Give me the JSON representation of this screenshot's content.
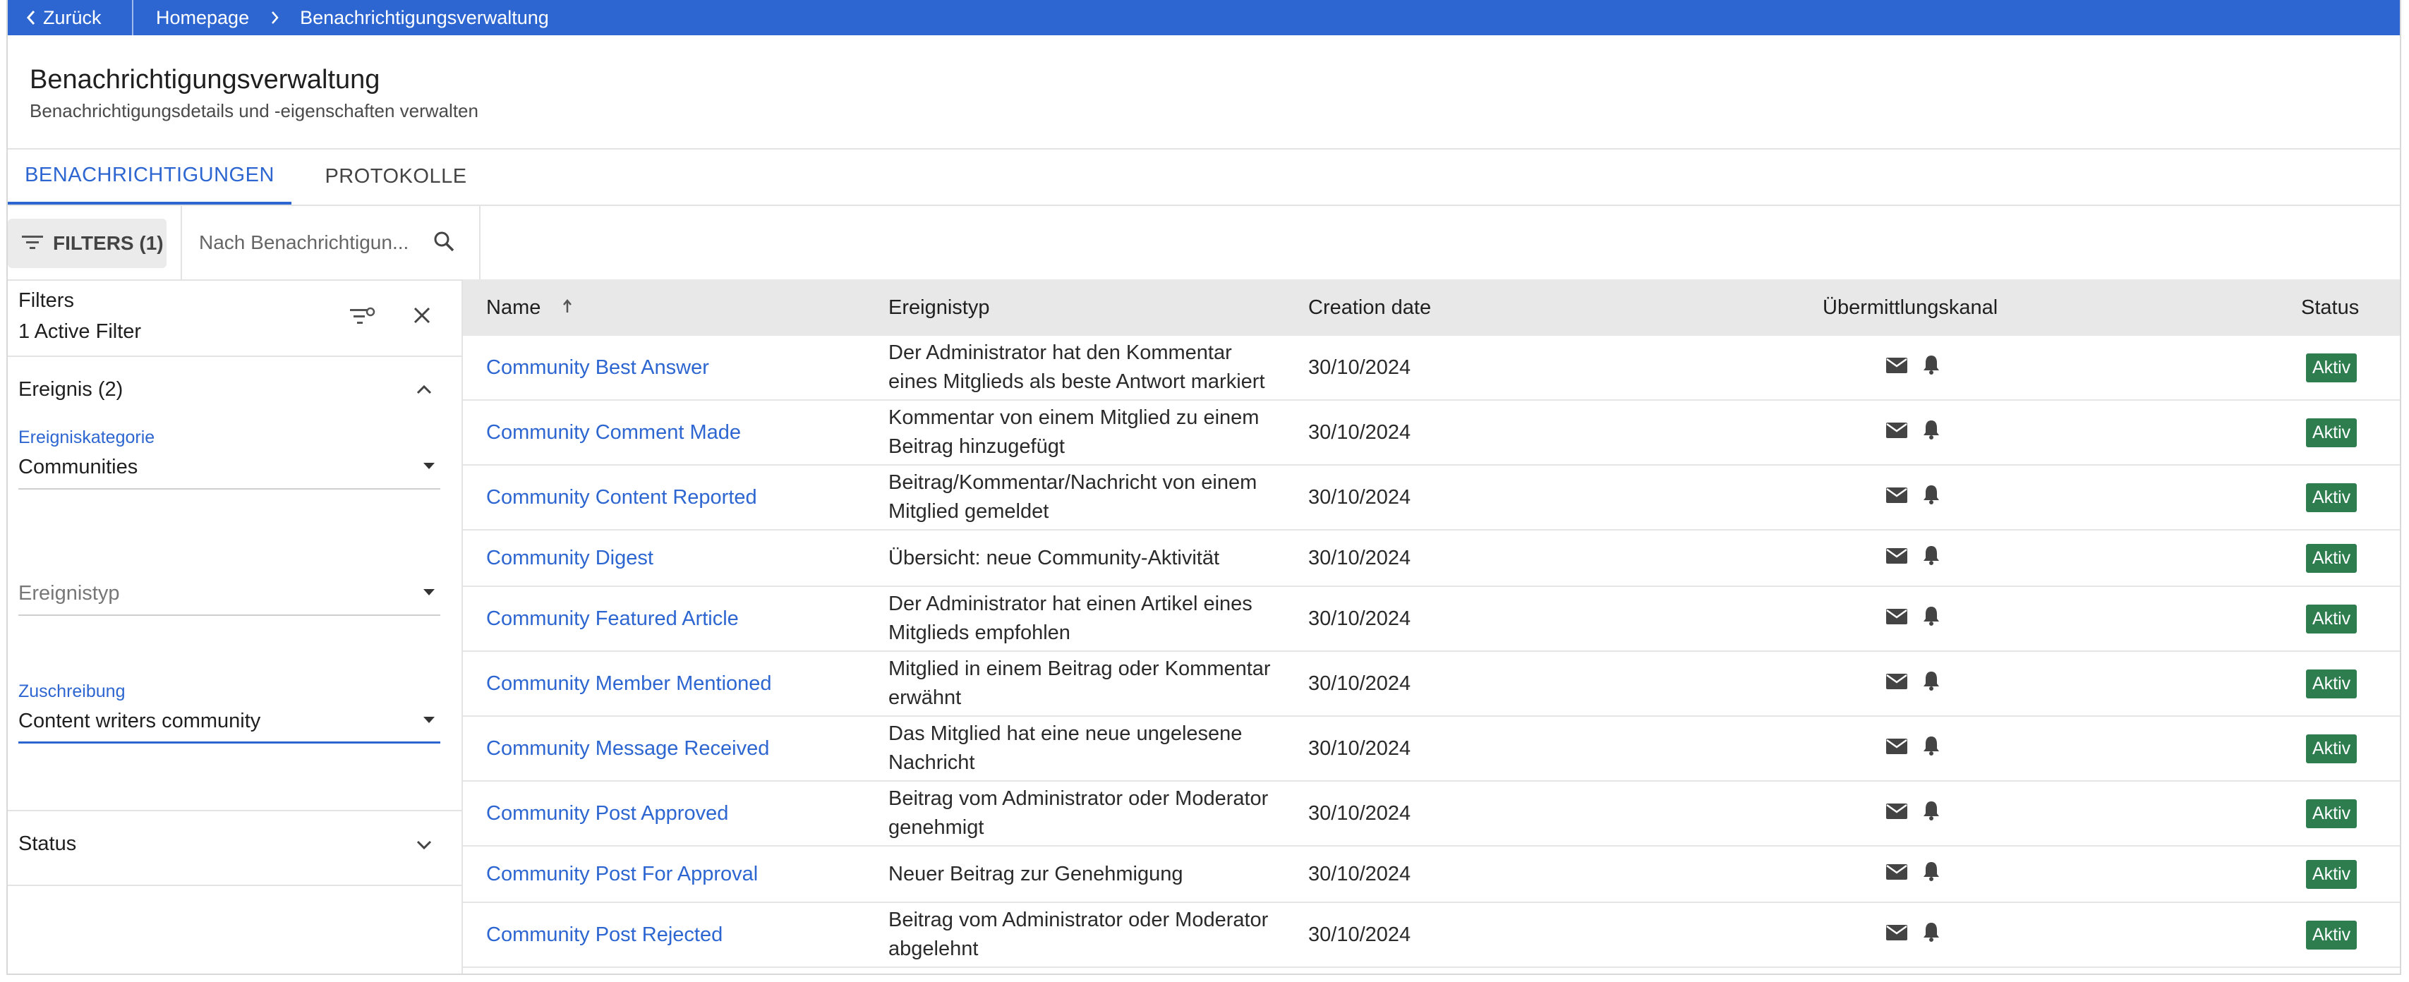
{
  "topbar": {
    "back_label": "Zurück",
    "breadcrumb": [
      "Homepage",
      "Benachrichtigungsverwaltung"
    ]
  },
  "header": {
    "title": "Benachrichtigungsverwaltung",
    "subtitle": "Benachrichtigungsdetails und -eigenschaften verwalten"
  },
  "tabs": [
    {
      "label": "BENACHRICHTIGUNGEN",
      "active": true
    },
    {
      "label": "PROTOKOLLE",
      "active": false
    }
  ],
  "toolbar": {
    "filters_label": "FILTERS (1)",
    "search_placeholder": "Nach Benachrichtigun..."
  },
  "filters": {
    "title": "Filters",
    "active_count": "1 Active Filter",
    "section_event": "Ereignis (2)",
    "category_label": "Ereigniskategorie",
    "category_value": "Communities",
    "type_placeholder": "Ereignistyp",
    "assignment_label": "Zuschreibung",
    "assignment_value": "Content writers community",
    "section_status": "Status"
  },
  "table": {
    "columns": {
      "name": "Name",
      "event_type": "Ereignistyp",
      "creation_date": "Creation date",
      "channel": "Übermittlungskanal",
      "status": "Status"
    },
    "rows": [
      {
        "name": "Community Best Answer",
        "event_type": "Der Administrator hat den Kommentar eines Mitglieds als beste Antwort markiert",
        "date": "30/10/2024",
        "status": "Aktiv"
      },
      {
        "name": "Community Comment Made",
        "event_type": "Kommentar von einem Mitglied zu einem Beitrag hinzugefügt",
        "date": "30/10/2024",
        "status": "Aktiv"
      },
      {
        "name": "Community Content Reported",
        "event_type": "Beitrag/Kommentar/Nachricht von einem Mitglied gemeldet",
        "date": "30/10/2024",
        "status": "Aktiv"
      },
      {
        "name": "Community Digest",
        "event_type": "Übersicht: neue Community-Aktivität",
        "date": "30/10/2024",
        "status": "Aktiv"
      },
      {
        "name": "Community Featured Article",
        "event_type": "Der Administrator hat einen Artikel eines Mitglieds empfohlen",
        "date": "30/10/2024",
        "status": "Aktiv"
      },
      {
        "name": "Community Member Mentioned",
        "event_type": "Mitglied in einem Beitrag oder Kommentar erwähnt",
        "date": "30/10/2024",
        "status": "Aktiv"
      },
      {
        "name": "Community Message Received",
        "event_type": "Das Mitglied hat eine neue ungelesene Nachricht",
        "date": "30/10/2024",
        "status": "Aktiv"
      },
      {
        "name": "Community Post Approved",
        "event_type": "Beitrag vom Administrator oder Moderator genehmigt",
        "date": "30/10/2024",
        "status": "Aktiv"
      },
      {
        "name": "Community Post For Approval",
        "event_type": "Neuer Beitrag zur Genehmigung",
        "date": "30/10/2024",
        "status": "Aktiv"
      },
      {
        "name": "Community Post Rejected",
        "event_type": "Beitrag vom Administrator oder Moderator abgelehnt",
        "date": "30/10/2024",
        "status": "Aktiv"
      }
    ]
  },
  "colors": {
    "accent": "#2d66d1",
    "status_active": "#2e7d4f",
    "header_bg": "#e8e8e8"
  },
  "icons": {
    "channel": [
      "mail-icon",
      "bell-icon"
    ]
  }
}
